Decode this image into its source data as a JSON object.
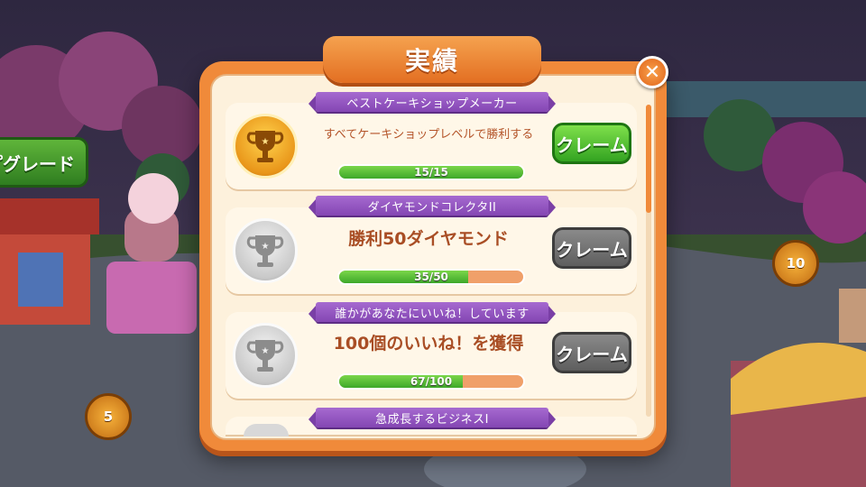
{
  "background": {
    "upgrade_label": "プグレード",
    "level_badge_right": "10",
    "level_badge_left": "5"
  },
  "dialog": {
    "title": "実績",
    "close_icon": "close-icon"
  },
  "achievements": [
    {
      "ribbon": "ベストケーキショップメーカー",
      "description": "すべてケーキショップレベルで勝利する",
      "progress_text": "15/15",
      "progress_fraction": 1.0,
      "trophy": "gold",
      "claim_label": "クレーム",
      "claim_state": "active"
    },
    {
      "ribbon": "ダイヤモンドコレクタII",
      "description": "勝利50ダイヤモンド",
      "progress_text": "35/50",
      "progress_fraction": 0.7,
      "trophy": "silver",
      "claim_label": "クレーム",
      "claim_state": "disabled"
    },
    {
      "ribbon": "誰かがあなたにいいね！しています",
      "description": "100個のいいね！を獲得",
      "progress_text": "67/100",
      "progress_fraction": 0.67,
      "trophy": "silver",
      "claim_label": "クレーム",
      "claim_state": "disabled"
    },
    {
      "ribbon": "急成長するビジネスI"
    }
  ],
  "colors": {
    "dialog_orange": "#f08a3a",
    "ribbon_purple": "#8446b3",
    "claim_green": "#33a321",
    "claim_gray": "#5e5e5e",
    "progress_green": "#3ea82a"
  }
}
